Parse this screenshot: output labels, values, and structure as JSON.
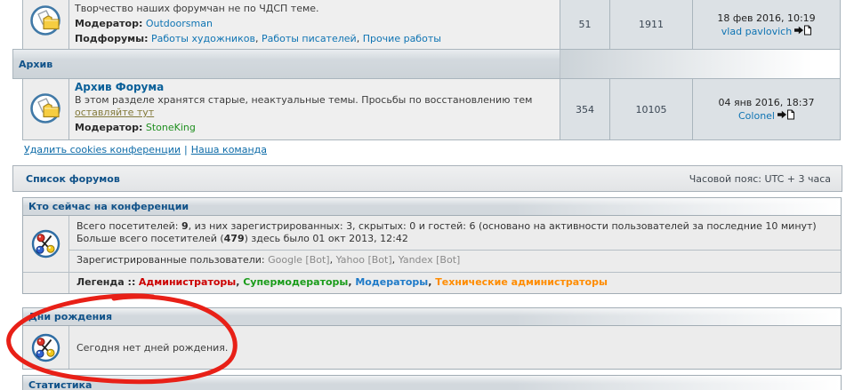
{
  "forum_table": {
    "partial_row": {
      "description": "Творчество наших форумчан не по ЧДСП теме.",
      "moderator_label": "Модератор:",
      "moderator": "Outdoorsman",
      "subforums_label": "Подфорумы:",
      "subforums": [
        "Работы художников",
        "Работы писателей",
        "Прочие работы"
      ],
      "topics": "51",
      "posts": "1911",
      "last_post_date": "18 фев 2016, 10:19",
      "last_post_user": "vlad pavlovich"
    },
    "category": "Архив",
    "archive_row": {
      "title": "Архив Форума",
      "description": "В этом разделе хранятся старые, неактуальные темы. Просьбы по восстановлению тем",
      "description_link": "оставляйте тут",
      "moderator_label": "Модератор:",
      "moderator": "StoneKing",
      "topics": "354",
      "posts": "10105",
      "last_post_date": "04 янв 2016, 18:37",
      "last_post_user": "Colonel"
    }
  },
  "footer_links": {
    "delete_cookies": "Удалить cookies конференции",
    "separator": "|",
    "team": "Наша команда"
  },
  "forumlist_bar": {
    "title": "Список форумов",
    "timezone": "Часовой пояс: UTC + 3 часа"
  },
  "whoisonline": {
    "header": "Кто сейчас на конференции",
    "line1_prefix": "Всего посетителей: ",
    "line1_bold": "9",
    "line1_suffix": ", из них зарегистрированных: 3, скрытых: 0 и гостей: 6 (основано на активности пользователей за последние 10 минут)",
    "line2_prefix": "Больше всего посетителей (",
    "line2_bold": "479",
    "line2_suffix": ") здесь было 01 окт 2013, 12:42",
    "registered_label": "Зарегистрированные пользователи: ",
    "registered_users": [
      "Google [Bot]",
      "Yahoo [Bot]",
      "Yandex [Bot]"
    ],
    "legend_label": "Легенда ::",
    "legend": [
      {
        "label": "Администраторы",
        "color": "#CC0000"
      },
      {
        "label": "Супермодераторы",
        "color": "#1a9c1a"
      },
      {
        "label": "Модераторы",
        "color": "#1e7ac8"
      },
      {
        "label": "Технические администраторы",
        "color": "#ff8c00"
      }
    ]
  },
  "birthdays": {
    "header": "Дни рождения",
    "text": "Сегодня нет дней рождения."
  },
  "statistics": {
    "header": "Статистика"
  },
  "colors": {
    "annotation": "#e82017",
    "accent_link": "#0f74b3",
    "category_title": "#105289"
  }
}
